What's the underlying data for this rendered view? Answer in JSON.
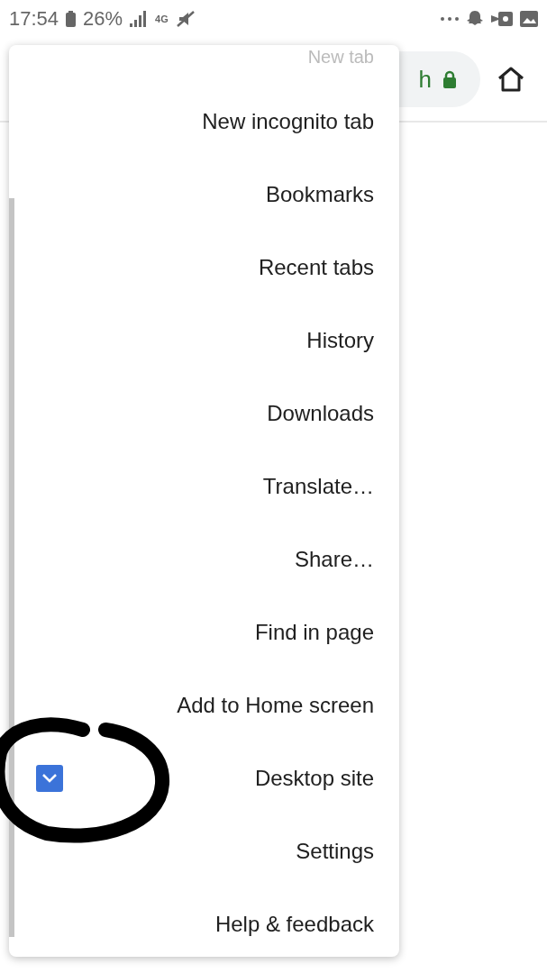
{
  "status_bar": {
    "time": "17:54",
    "battery": "26%",
    "network": "4G"
  },
  "toolbar": {
    "url": "h"
  },
  "menu": {
    "items": [
      {
        "label": "New tab",
        "kind": "cut"
      },
      {
        "label": "New incognito tab",
        "kind": "item"
      },
      {
        "label": "Bookmarks",
        "kind": "item"
      },
      {
        "label": "Recent tabs",
        "kind": "item"
      },
      {
        "label": "History",
        "kind": "item"
      },
      {
        "label": "Downloads",
        "kind": "item"
      },
      {
        "label": "Translate…",
        "kind": "item"
      },
      {
        "label": "Share…",
        "kind": "item"
      },
      {
        "label": "Find in page",
        "kind": "item"
      },
      {
        "label": "Add to Home screen",
        "kind": "item"
      },
      {
        "label": "Desktop site",
        "kind": "checkbox",
        "checked": true
      },
      {
        "label": "Settings",
        "kind": "item"
      },
      {
        "label": "Help & feedback",
        "kind": "item"
      }
    ]
  }
}
